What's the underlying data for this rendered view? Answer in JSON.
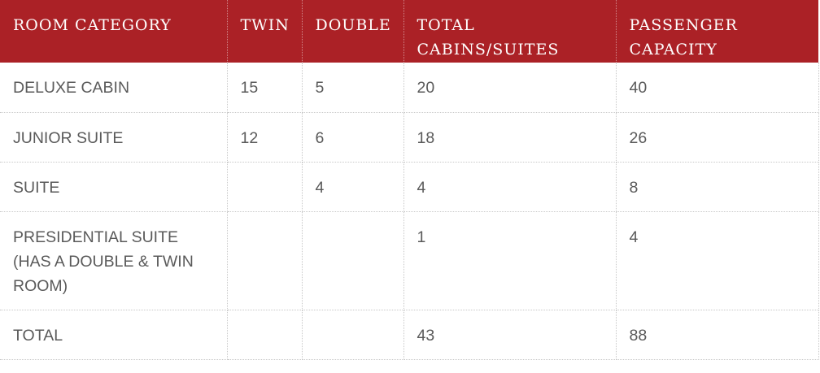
{
  "table": {
    "headers": [
      "ROOM CATEGORY",
      "TWIN",
      "DOUBLE",
      "TOTAL CABINS/SUITES",
      "PASSENGER CAPACITY"
    ],
    "rows": [
      [
        "DELUXE CABIN",
        "15",
        "5",
        "20",
        "40"
      ],
      [
        "JUNIOR SUITE",
        "12",
        "6",
        "18",
        "26"
      ],
      [
        "SUITE",
        "",
        "4",
        "4",
        "8"
      ],
      [
        "PRESIDENTIAL SUITE (HAS A DOUBLE & TWIN ROOM)",
        "",
        "",
        "1",
        "4"
      ],
      [
        "TOTAL",
        "",
        "",
        "43",
        "88"
      ]
    ]
  },
  "colors": {
    "header_background": "#ab2126",
    "header_text": "#ffffff",
    "body_text": "#5a5a5a"
  }
}
